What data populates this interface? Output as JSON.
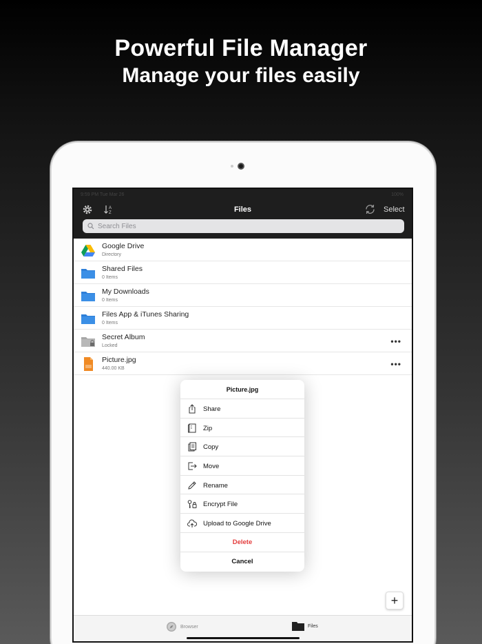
{
  "promo": {
    "title": "Powerful File Manager",
    "subtitle": "Manage your files easily"
  },
  "status_bar": {
    "time": "9:59 PM  Tue Mar 26",
    "battery": "100%"
  },
  "navbar": {
    "title": "Files",
    "select_label": "Select",
    "search_placeholder": "Search Files"
  },
  "files": [
    {
      "name": "Google Drive",
      "sub": "Directory",
      "icon": "google-drive-icon"
    },
    {
      "name": "Shared Files",
      "sub": "0 Items",
      "icon": "folder-icon"
    },
    {
      "name": "My Downloads",
      "sub": "0 Items",
      "icon": "folder-icon"
    },
    {
      "name": "Files App & iTunes Sharing",
      "sub": "0 Items",
      "icon": "folder-icon"
    },
    {
      "name": "Secret Album",
      "sub": "Locked",
      "icon": "locked-folder-icon"
    },
    {
      "name": "Picture.jpg",
      "sub": "440.00 KB",
      "icon": "jpg-file-icon"
    }
  ],
  "more_glyph": "•••",
  "popover": {
    "title": "Picture.jpg",
    "items": [
      {
        "label": "Share",
        "icon": "share-icon"
      },
      {
        "label": "Zip",
        "icon": "zip-icon"
      },
      {
        "label": "Copy",
        "icon": "copy-icon"
      },
      {
        "label": "Move",
        "icon": "move-icon"
      },
      {
        "label": "Rename",
        "icon": "pencil-icon"
      },
      {
        "label": "Encrypt File",
        "icon": "key-lock-icon"
      },
      {
        "label": "Upload to Google Drive",
        "icon": "cloud-upload-icon"
      }
    ],
    "delete_label": "Delete",
    "cancel_label": "Cancel"
  },
  "fab_label": "+",
  "tabs": [
    {
      "label": "Browser",
      "icon": "compass-icon"
    },
    {
      "label": "Files",
      "icon": "folder-tab-icon"
    }
  ],
  "colors": {
    "folder": "#2d7fd8",
    "delete": "#e33b3b",
    "navbar": "#1e1e1e",
    "jpg": "#f08a24"
  }
}
